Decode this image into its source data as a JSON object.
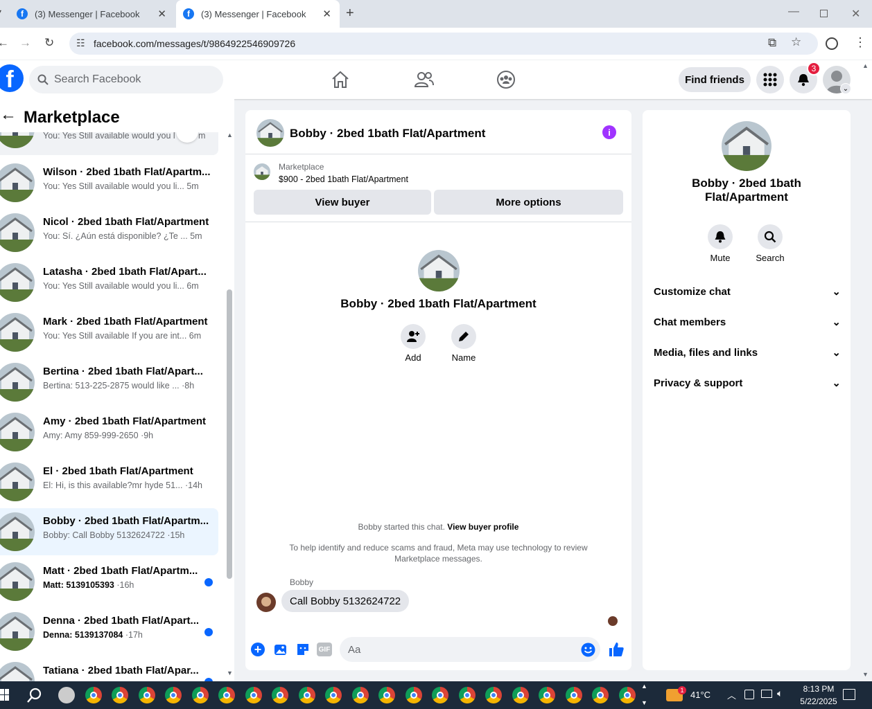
{
  "browser": {
    "tabs": [
      {
        "title": "(3) Messenger | Facebook"
      },
      {
        "title": "(3) Messenger | Facebook"
      }
    ],
    "url": "facebook.com/messages/t/9864922546909726"
  },
  "fb": {
    "search_placeholder": "Search Facebook",
    "find_friends": "Find friends",
    "notif_count": "3"
  },
  "left": {
    "title": "Marketplace",
    "partial_preview": "You: Yes Still available would you l",
    "partial_time": "m",
    "conversations": [
      {
        "name": "Wilson · 2bed 1bath Flat/Apartm...",
        "preview": "You: Yes Still available would you li...",
        "time": "5m",
        "unread": false
      },
      {
        "name": "Nicol · 2bed 1bath Flat/Apartment",
        "preview": "You: Sí. ¿Aún está disponible? ¿Te ...",
        "time": "5m",
        "unread": false
      },
      {
        "name": "Latasha · 2bed 1bath Flat/Apart...",
        "preview": "You: Yes Still available would you li...",
        "time": "6m",
        "unread": false
      },
      {
        "name": "Mark · 2bed 1bath Flat/Apartment",
        "preview": "You: Yes Still available If you are int...",
        "time": "6m",
        "unread": false
      },
      {
        "name": "Bertina · 2bed 1bath Flat/Apart...",
        "preview": "Bertina: 513-225-2875 would like ...",
        "time": "·8h",
        "unread": false
      },
      {
        "name": "Amy · 2bed 1bath Flat/Apartment",
        "preview": "Amy: Amy 859-999-2650",
        "time": "·9h",
        "unread": false
      },
      {
        "name": "El · 2bed 1bath Flat/Apartment",
        "preview": "El: Hi, is this available?mr hyde 51...",
        "time": "·14h",
        "unread": false
      },
      {
        "name": "Bobby · 2bed 1bath Flat/Apartm...",
        "preview": "Bobby: Call Bobby 5132624722",
        "time": "·15h",
        "unread": false,
        "selected": true
      },
      {
        "name": "Matt · 2bed 1bath Flat/Apartm...",
        "preview": "Matt: 5139105393",
        "time": "·16h",
        "unread": true
      },
      {
        "name": "Denna · 2bed 1bath Flat/Apart...",
        "preview": "Denna: 5139137084",
        "time": "·17h",
        "unread": true
      },
      {
        "name": "Tatiana · 2bed 1bath Flat/Apar...",
        "preview": "",
        "time": "",
        "unread": true
      }
    ]
  },
  "chat": {
    "header_title": "Bobby · 2bed 1bath Flat/Apartment",
    "listing_source": "Marketplace",
    "listing_title": "$900 - 2bed 1bath Flat/Apartment",
    "view_buyer": "View buyer",
    "more_options": "More options",
    "center_title": "Bobby · 2bed 1bath Flat/Apartment",
    "add_label": "Add",
    "name_label": "Name",
    "started_text": "Bobby started this chat.",
    "view_profile": "View buyer profile",
    "scam_notice": "To help identify and reduce scams and fraud, Meta may use technology to review Marketplace messages.",
    "sender": "Bobby",
    "message": "Call Bobby 5132624722",
    "input_placeholder": "Aa",
    "gif": "GIF"
  },
  "info": {
    "title": "Bobby · 2bed 1bath Flat/Apartment",
    "mute": "Mute",
    "search": "Search",
    "sections": [
      "Customize chat",
      "Chat members",
      "Media, files and links",
      "Privacy & support"
    ]
  },
  "taskbar": {
    "weather_badge": "1",
    "temp": "41°C",
    "time": "8:13 PM",
    "date": "5/22/2025"
  },
  "colors": {
    "fb_blue": "#0866ff",
    "info_purple": "#a033ff",
    "badge_red": "#e41e3f"
  }
}
